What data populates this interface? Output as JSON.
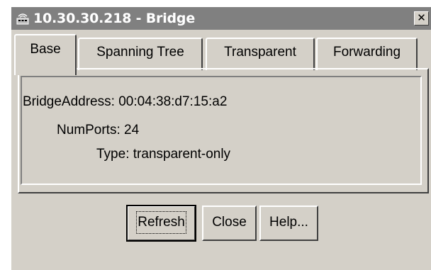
{
  "window": {
    "title": "10.30.30.218 - Bridge",
    "icon": "network-device-icon",
    "close_label": "✕"
  },
  "tabs": [
    {
      "label": "Base",
      "active": true
    },
    {
      "label": "Spanning Tree",
      "active": false
    },
    {
      "label": "Transparent",
      "active": false
    },
    {
      "label": "Forwarding",
      "active": false
    }
  ],
  "fields": {
    "bridge_address": {
      "label": "BridgeAddress:",
      "value": "00:04:38:d7:15:a2"
    },
    "num_ports": {
      "label": "NumPorts:",
      "value": "24"
    },
    "type": {
      "label": "Type:",
      "value": "transparent-only"
    }
  },
  "buttons": {
    "refresh": "Refresh",
    "close": "Close",
    "help": "Help..."
  },
  "colors": {
    "dialog_bg": "#d4d0c8",
    "titlebar_bg": "#808080",
    "titlebar_text": "#ffffff"
  }
}
